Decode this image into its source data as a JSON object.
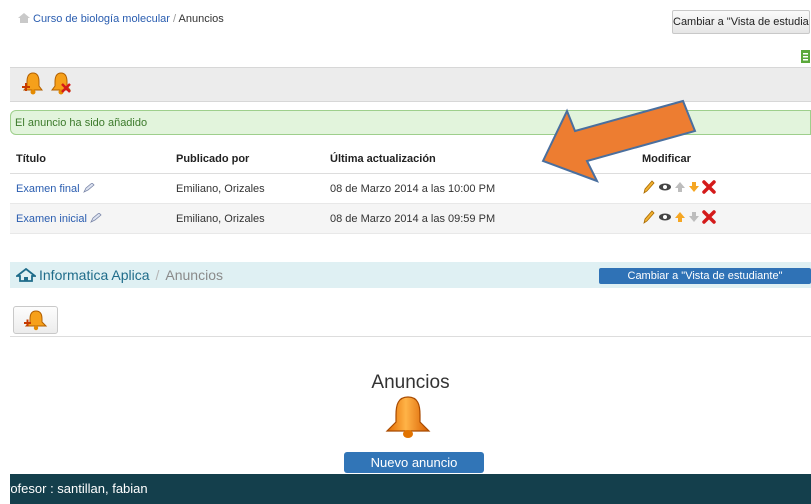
{
  "old_ui": {
    "breadcrumb": {
      "course": "Curso de biología molecular",
      "separator": "/",
      "current": "Anuncios"
    },
    "student_view_button": "Cambiar a \"Vista de estudiante\"",
    "success_message": "El anuncio ha sido añadido",
    "table": {
      "headers": [
        "Título",
        "Publicado por",
        "Última actualización",
        "Modificar"
      ],
      "rows": [
        {
          "title": "Examen final",
          "author": "Emiliano, Orizales",
          "updated": "08 de Marzo 2014 a las 10:00 PM"
        },
        {
          "title": "Examen inicial",
          "author": "Emiliano, Orizales",
          "updated": "08 de Marzo 2014 a las 09:59 PM"
        }
      ]
    }
  },
  "new_ui": {
    "breadcrumb": {
      "course": "Informatica Aplica",
      "separator": "/",
      "current": "Anuncios"
    },
    "student_view_button": "Cambiar a \"Vista de estudiante\"",
    "heading": "Anuncios",
    "new_button": "Nuevo anuncio",
    "footer": "rofesor : santillan, fabian"
  },
  "colors": {
    "arrow": "#ed7d31",
    "accent_blue": "#3175b7",
    "footer_bg": "#143f4c",
    "success_bg": "#e2f4dc"
  },
  "icons": [
    "house-icon",
    "bell-add-icon",
    "bell-delete-icon",
    "edit-icon",
    "visibility-icon",
    "move-up-icon",
    "move-down-icon",
    "delete-icon",
    "export-icon"
  ]
}
